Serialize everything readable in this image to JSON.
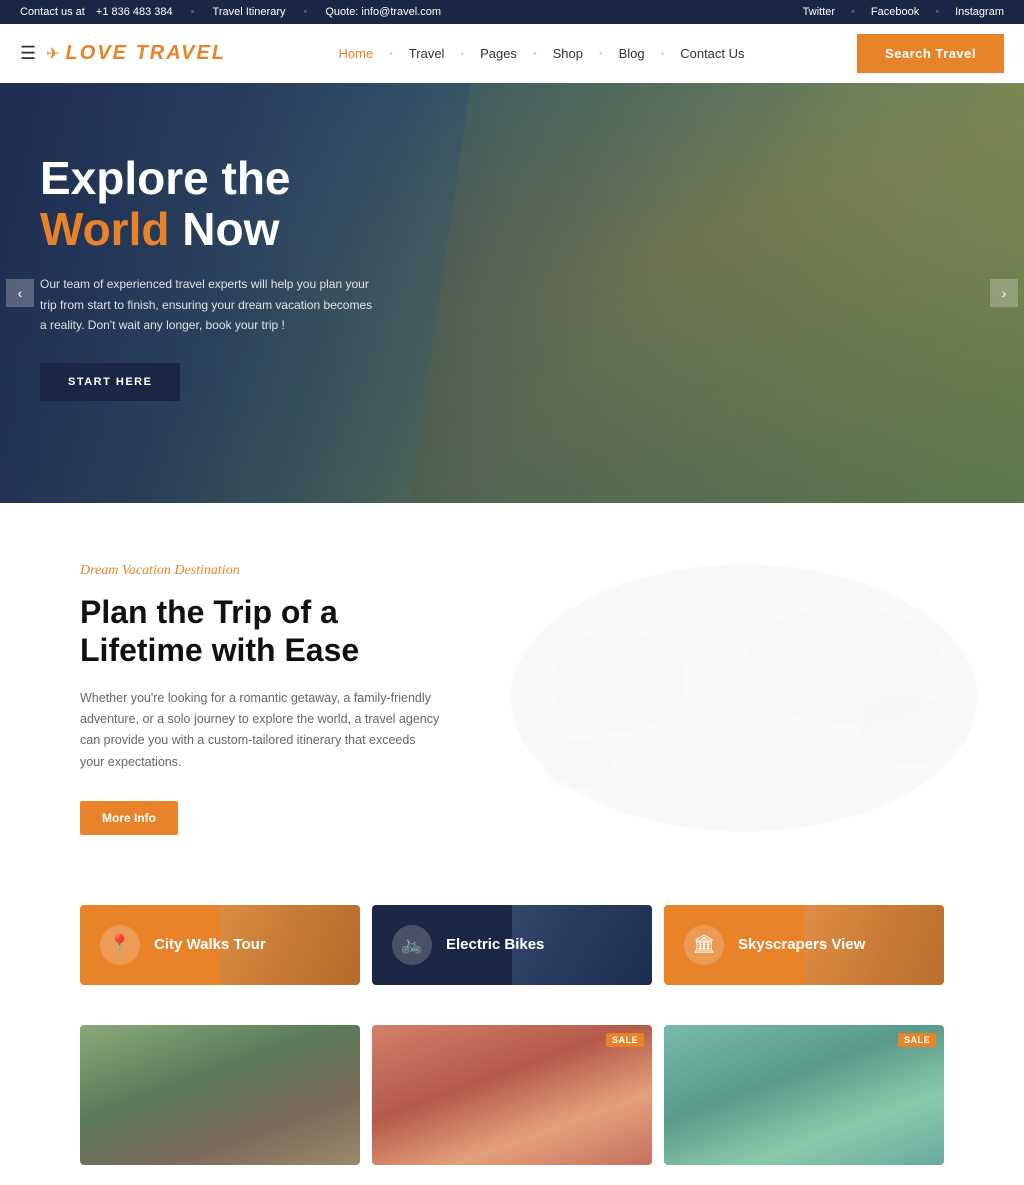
{
  "topbar": {
    "contact_label": "Contact us at",
    "phone": "+1 836 483 384",
    "itinerary_label": "Travel Itinerary",
    "quote_label": "Quote: info@travel.com",
    "social": [
      "Twitter",
      "Facebook",
      "Instagram"
    ]
  },
  "header": {
    "logo_text_part1": "Love",
    "logo_text_part2": "Travel",
    "nav_items": [
      {
        "label": "Home",
        "active": true
      },
      {
        "label": "Travel",
        "active": false
      },
      {
        "label": "Pages",
        "active": false
      },
      {
        "label": "Shop",
        "active": false
      },
      {
        "label": "Blog",
        "active": false
      },
      {
        "label": "Contact Us",
        "active": false
      }
    ],
    "search_btn": "Search Travel"
  },
  "hero": {
    "title_part1": "Explore the",
    "title_highlight": "World",
    "title_part2": "Now",
    "description": "Our team of experienced travel experts will help you plan your trip from start to finish, ensuring your dream vacation becomes a reality. Don't wait any longer, book your trip !",
    "cta_btn": "START HERE",
    "arrow_left": "‹",
    "arrow_right": "›"
  },
  "dream_section": {
    "subtitle": "Dream Vacation Destination",
    "title": "Plan the Trip of a Lifetime with Ease",
    "description": "Whether you're looking for a romantic getaway, a family-friendly adventure, or a solo journey to explore the world, a travel agency can provide you with a custom-tailored itinerary that exceeds your expectations.",
    "more_info_btn": "More Info"
  },
  "tour_cards": [
    {
      "label": "City Walks Tour",
      "icon": "📍",
      "color": "orange"
    },
    {
      "label": "Electric Bikes",
      "icon": "🚲",
      "color": "navy"
    },
    {
      "label": "Skyscrapers View",
      "icon": "🏛",
      "color": "orange"
    }
  ],
  "gallery": [
    {
      "has_sale": false
    },
    {
      "has_sale": true,
      "sale_label": "SALE"
    },
    {
      "has_sale": true,
      "sale_label": "SALE"
    }
  ]
}
